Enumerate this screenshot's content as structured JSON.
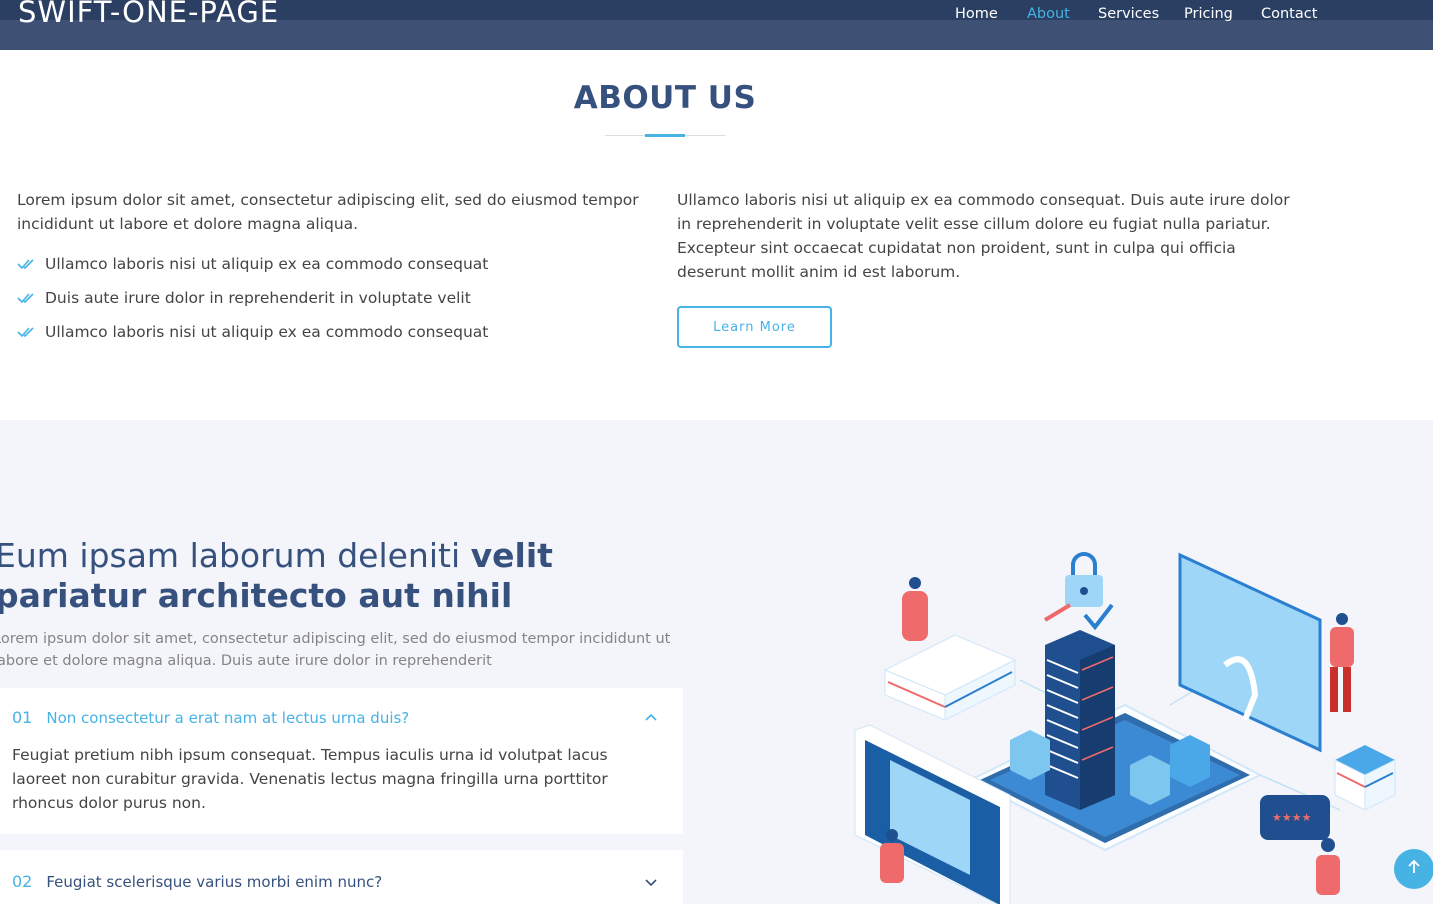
{
  "header": {
    "logo": "SWIFT-ONE-PAGE",
    "nav": [
      {
        "label": "Home",
        "active": false
      },
      {
        "label": "About",
        "active": true
      },
      {
        "label": "Services",
        "active": false
      },
      {
        "label": "Pricing",
        "active": false
      },
      {
        "label": "Contact",
        "active": false
      }
    ],
    "colors": {
      "bar": "#3e5073",
      "bar_top": "#2b3f63",
      "active": "#47b2e4"
    }
  },
  "about": {
    "title": "ABOUT US",
    "left_paragraph": "Lorem ipsum dolor sit amet, consectetur adipiscing elit, sed do eiusmod tempor incididunt ut labore et dolore magna aliqua.",
    "checklist": [
      "Ullamco laboris nisi ut aliquip ex ea commodo consequat",
      "Duis aute irure dolor in reprehenderit in voluptate velit",
      "Ullamco laboris nisi ut aliquip ex ea commodo consequat"
    ],
    "checklist_icon": "double-check-icon",
    "right_paragraph": "Ullamco laboris nisi ut aliquip ex ea commodo consequat. Duis aute irure dolor in reprehenderit in voluptate velit esse cillum dolore eu fugiat nulla pariatur. Excepteur sint occaecat cupidatat non proident, sunt in culpa qui officia deserunt mollit anim id est laborum.",
    "button_label": "Learn More"
  },
  "why_us": {
    "title_regular": "Eum ipsam laborum deleniti ",
    "title_bold": "velit pariatur architecto aut nihil",
    "paragraph": "Lorem ipsum dolor sit amet, consectetur adipiscing elit, sed do eiusmod tempor incididunt ut labore et dolore magna aliqua. Duis aute irure dolor in reprehenderit",
    "accordion": [
      {
        "number": "01",
        "question": "Non consectetur a erat nam at lectus urna duis?",
        "answer": "Feugiat pretium nibh ipsum consequat. Tempus iaculis urna id volutpat lacus laoreet non curabitur gravida. Venenatis lectus magna fringilla urna porttitor rhoncus dolor purus non.",
        "expanded": true,
        "chevron": "chevron-up-icon"
      },
      {
        "number": "02",
        "question": "Feugiat scelerisque varius morbi enim nunc?",
        "expanded": false,
        "chevron": "chevron-down-icon"
      }
    ],
    "illustration": "isometric-city-illustration",
    "background": "#f3f5fa"
  },
  "back_to_top_icon": "arrow-up-icon",
  "accent_color": "#47b2e4",
  "heading_color": "#37517e"
}
